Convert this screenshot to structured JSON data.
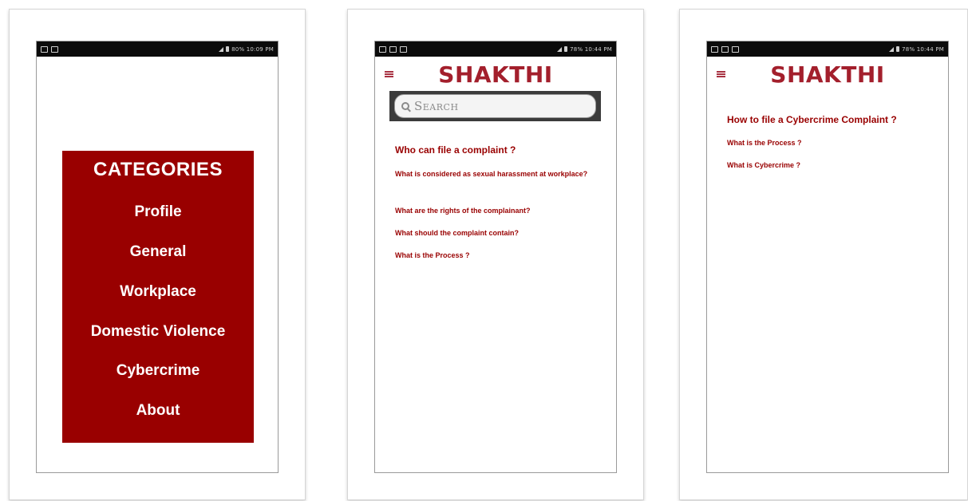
{
  "screens": [
    {
      "status_bar": {
        "text": "80%  10:09 PM"
      },
      "categories": {
        "title": "CATEGORIES",
        "items": [
          "Profile",
          "General",
          "Workplace",
          "Domestic Violence",
          "Cybercrime",
          "About"
        ]
      }
    },
    {
      "status_bar": {
        "text": "78%  10:44 PM"
      },
      "logo": "SHAKTHI",
      "search": {
        "placeholder": "Search"
      },
      "questions": [
        "Who can file a complaint ?",
        "What is considered as sexual  harassment at workplace?",
        "What are the rights of the complainant?",
        "What should the complaint contain?",
        "What is the Process ?"
      ]
    },
    {
      "status_bar": {
        "text": "78%  10:44 PM"
      },
      "logo": "SHAKTHI",
      "questions": [
        "How to file a Cybercrime Complaint ?",
        "What is the Process ?",
        "What is Cybercrime ?"
      ]
    }
  ],
  "colors": {
    "accent": "#990000",
    "logo": "#a31f2c",
    "statusbar": "#0b0b0b"
  }
}
